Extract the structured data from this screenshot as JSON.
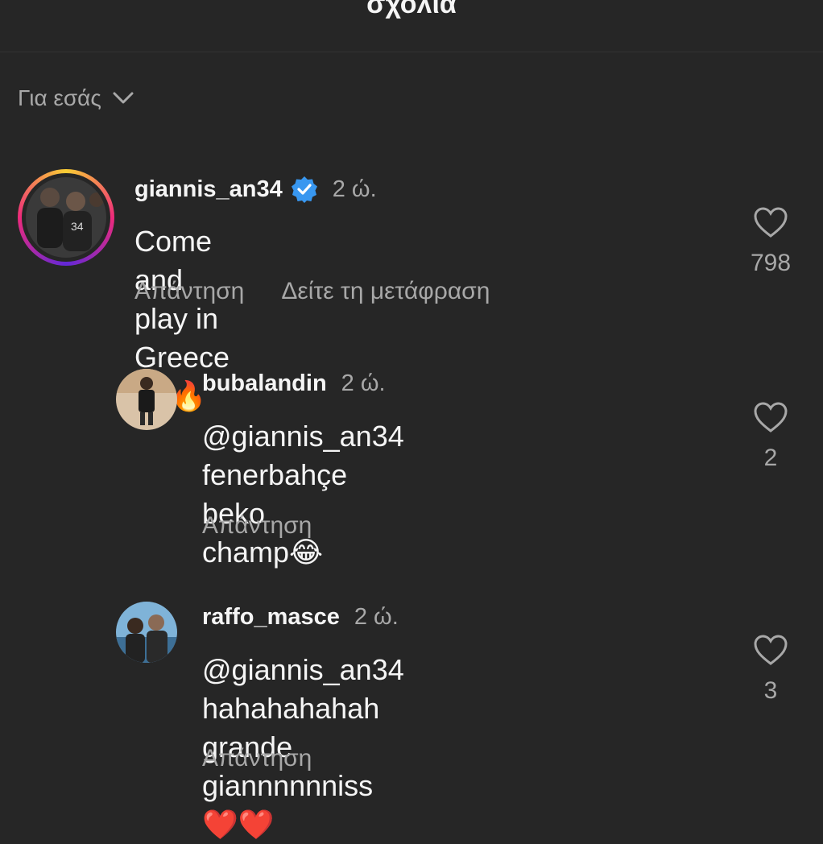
{
  "header": {
    "title": "σχολια"
  },
  "sort": {
    "label": "Για εσάς",
    "icon": "chevron-down-icon"
  },
  "comments": [
    {
      "username": "giannis_an34",
      "verified": true,
      "time": "2 ώ.",
      "text": "Come and play in Greece 🐐🔥",
      "reply_label": "Απάντηση",
      "translate_label": "Δείτε τη μετάφραση",
      "likes": "798"
    },
    {
      "username": "bubalandin",
      "time": "2 ώ.",
      "text_line1": "@giannis_an34 fenerbahçe beko",
      "text_line2": "champ😂",
      "reply_label": "Απάντηση",
      "likes": "2"
    },
    {
      "username": "raffo_masce",
      "time": "2 ώ.",
      "text_line1": "@giannis_an34 hahahahahah",
      "text_line2": "grande giannnnnniss❤️❤️",
      "reply_label": "Απάντηση",
      "likes": "3"
    }
  ],
  "colors": {
    "background": "#262626",
    "text_primary": "#f5f5f5",
    "text_secondary": "#a8a8a8",
    "verified": "#3897f0"
  }
}
